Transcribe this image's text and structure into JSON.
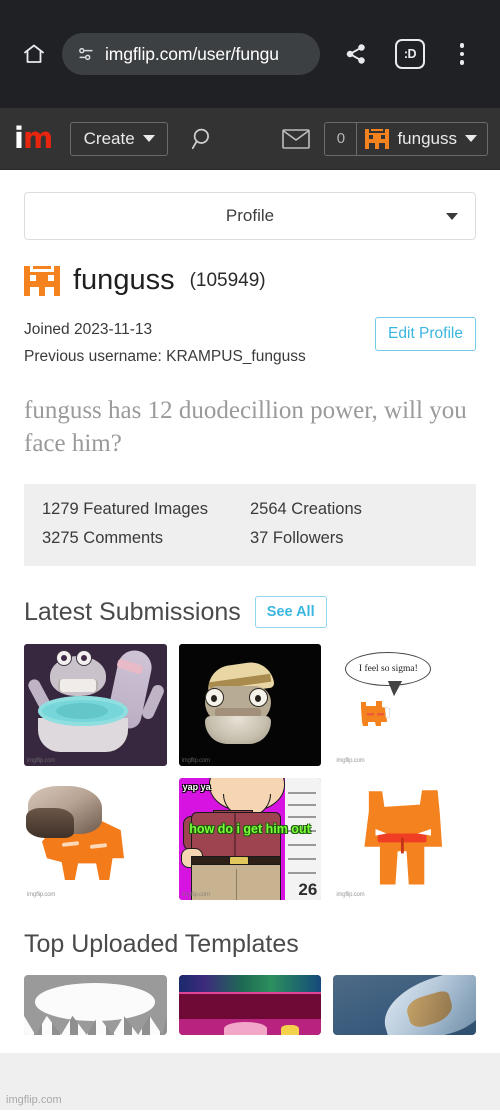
{
  "browser": {
    "home_icon": "home-icon",
    "permission_icon": "page-info-icon",
    "url": "imgflip.com/user/fungu",
    "share_icon": "share-icon",
    "emoji_label": ":D",
    "menu_icon": "overflow-menu-icon"
  },
  "site_header": {
    "logo_first": "i",
    "logo_second": "m",
    "create_label": "Create",
    "search_icon": "search-icon",
    "mail_icon": "mail-icon",
    "points": "0",
    "username": "funguss",
    "avatar_icon": "cat-avatar-icon"
  },
  "profile": {
    "select_label": "Profile",
    "username": "funguss",
    "points": "(105949)",
    "joined": "Joined 2023-11-13",
    "previous_username": "Previous username: KRAMPUS_funguss",
    "edit_label": "Edit Profile",
    "bio": "funguss has 12 duodecillion power, will you face him?",
    "stats": [
      "1279 Featured Images",
      "2564 Creations",
      "3275 Comments",
      "37 Followers"
    ]
  },
  "latest_submissions": {
    "heading": "Latest Submissions",
    "see_all_label": "See All",
    "watermark": "imgflip.com",
    "tiles": [
      {
        "name": "thumb-monster-bathtub",
        "caption": ""
      },
      {
        "name": "thumb-hat-fish",
        "caption": ""
      },
      {
        "name": "thumb-sigma-cat",
        "caption": "I feel so sigma!"
      },
      {
        "name": "thumb-hand-squeeze-cat",
        "caption": ""
      },
      {
        "name": "thumb-family-guy",
        "caption": "how do i\nget him out",
        "corner_text": "yap ya",
        "number": "26"
      },
      {
        "name": "thumb-orange-cat",
        "caption": ""
      }
    ]
  },
  "top_templates": {
    "heading": "Top Uploaded Templates",
    "tiles": [
      {
        "name": "template-teeth-cave"
      },
      {
        "name": "template-pink-glitch"
      },
      {
        "name": "template-ice-ridge"
      }
    ]
  },
  "footer": {
    "watermark": "imgflip.com"
  },
  "colors": {
    "chrome_bg": "#202124",
    "omnibox_bg": "#3c4043",
    "site_header_bg": "#333333",
    "brand_red": "#e8260f",
    "accent_blue": "#3ab7e0",
    "orange": "#f47b1a",
    "stats_bg": "#efefef"
  }
}
